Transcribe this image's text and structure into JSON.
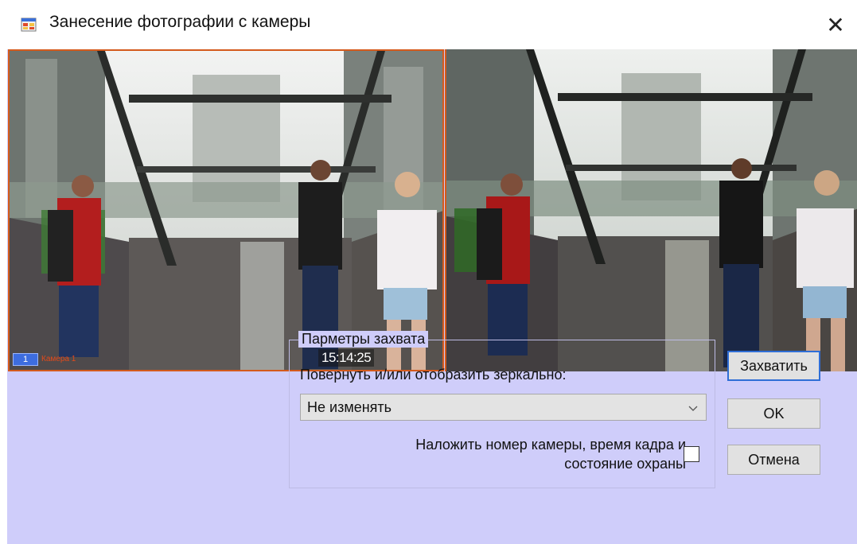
{
  "window": {
    "title": "Занесение фотографии с камеры",
    "close_glyph": "✕",
    "icon": "app-window-icon"
  },
  "video": {
    "camera_badge": "1",
    "camera_label": "Камера 1",
    "timestamp": "15:14:25"
  },
  "capture_params": {
    "group_title": "Парметры захвата",
    "rotate_label": "Повернуть и/или отобразить зеркально:",
    "rotate_value": "Не изменять",
    "overlay_label_line1": "Наложить номер камеры, время кадра и",
    "overlay_label_line2": "состояние охраны",
    "overlay_checked": false
  },
  "buttons": {
    "capture": "Захватить",
    "ok": "OK",
    "cancel": "Отмена"
  },
  "colors": {
    "client_bg": "#cfcdfa",
    "frame_border": "#d45a1c",
    "default_button_border": "#2f6ed6"
  }
}
